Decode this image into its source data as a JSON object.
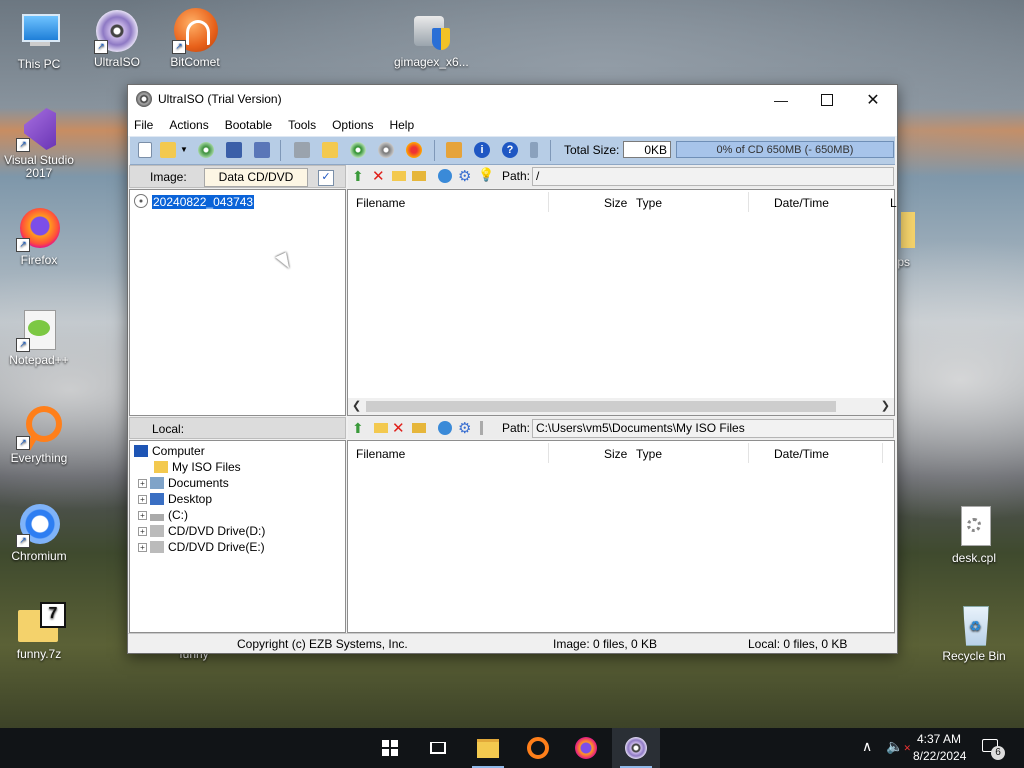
{
  "desktop": {
    "icons": [
      {
        "label": "This PC"
      },
      {
        "label": "UltraISO"
      },
      {
        "label": "BitComet"
      },
      {
        "label": "gimagex_x6..."
      },
      {
        "label": "Visual Studio 2017"
      },
      {
        "label": "Firefox"
      },
      {
        "label": "Notepad++"
      },
      {
        "label": "Everything"
      },
      {
        "label": "Chromium"
      },
      {
        "label": "funny.7z"
      },
      {
        "label": "funny"
      },
      {
        "label": "desk.cpl"
      },
      {
        "label": "Recycle Bin"
      },
      {
        "label": "ps"
      }
    ]
  },
  "window": {
    "title": "UltraISO (Trial Version)",
    "menu": [
      "File",
      "Actions",
      "Bootable",
      "Tools",
      "Options",
      "Help"
    ],
    "toolbar": {
      "total_size_label": "Total Size:",
      "total_size_value": "0KB",
      "capacity_text": "0% of CD 650MB (- 650MB)"
    },
    "image_panel": {
      "label": "Image:",
      "type_value": "Data CD/DVD",
      "tree_root": "20240822_043743",
      "path_label": "Path:",
      "path_value": "/"
    },
    "columns": [
      "Filename",
      "Size",
      "Type",
      "Date/Time",
      "L"
    ],
    "local_panel": {
      "label": "Local:",
      "path_label": "Path:",
      "path_value": "C:\\Users\\vm5\\Documents\\My ISO Files",
      "tree": [
        "Computer",
        "My ISO Files",
        "Documents",
        "Desktop",
        "(C:)",
        "CD/DVD Drive(D:)",
        "CD/DVD Drive(E:)"
      ]
    },
    "local_columns": [
      "Filename",
      "Size",
      "Type",
      "Date/Time"
    ],
    "status": {
      "copyright": "Copyright (c) EZB Systems, Inc.",
      "image": "Image: 0 files, 0 KB",
      "local": "Local: 0 files, 0 KB"
    }
  },
  "taskbar": {
    "time": "4:37 AM",
    "date": "8/22/2024",
    "notifications": "6"
  }
}
